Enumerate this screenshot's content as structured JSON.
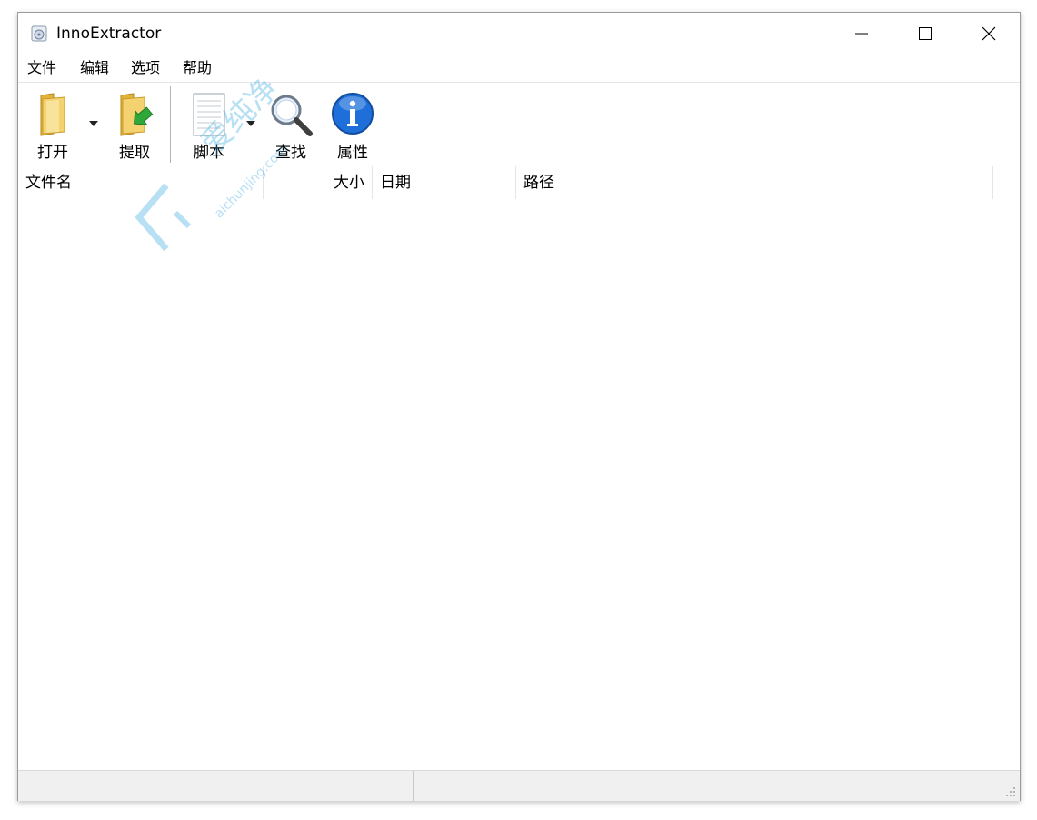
{
  "window": {
    "title": "InnoExtractor"
  },
  "menu": {
    "file": "文件",
    "edit": "编辑",
    "options": "选项",
    "help": "帮助"
  },
  "toolbar": {
    "open": "打开",
    "extract": "提取",
    "script": "脚本",
    "find": "查找",
    "properties": "属性"
  },
  "list": {
    "columns": {
      "name": "文件名",
      "size": "大小",
      "date": "日期",
      "path": "路径"
    },
    "rows": []
  },
  "status": {
    "left": "",
    "right": ""
  },
  "watermark": {
    "cn": "爱纯净",
    "url": "aichunjing.com"
  },
  "icons": {
    "app": "app-icon",
    "open": "folder-icon",
    "extract": "folder-extract-icon",
    "script": "notepad-icon",
    "find": "magnifier-icon",
    "properties": "info-icon"
  },
  "colors": {
    "accent_blue": "#1e6fd9",
    "folder_yellow": "#f1c74a",
    "green_arrow": "#2fa83a"
  }
}
